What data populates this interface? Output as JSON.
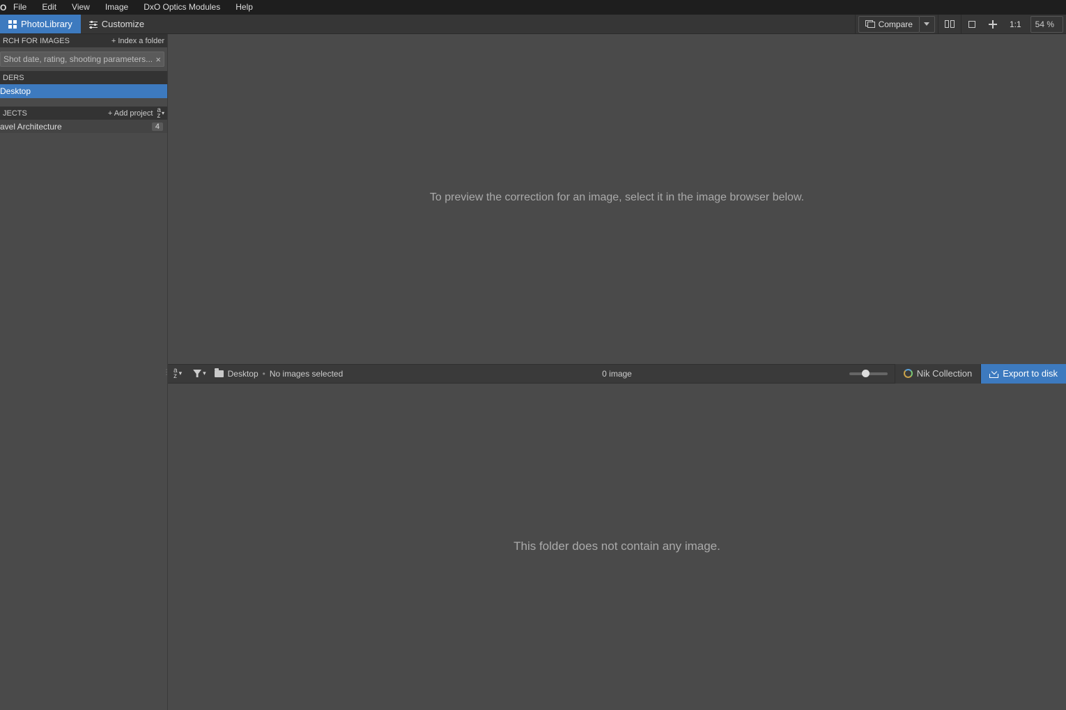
{
  "menubar": {
    "logo": "O",
    "items": [
      "File",
      "Edit",
      "View",
      "Image",
      "DxO Optics Modules",
      "Help"
    ]
  },
  "modebar": {
    "photolibrary": "PhotoLibrary",
    "customize": "Customize",
    "compare": "Compare",
    "ratio": "1:1",
    "zoom": "54 %"
  },
  "sidebar": {
    "search": {
      "header": "RCH FOR IMAGES",
      "index_action": "+ Index a folder",
      "placeholder": "Shot date, rating, shooting parameters..."
    },
    "folders": {
      "header": "DERS",
      "items": [
        {
          "name": "Desktop"
        }
      ]
    },
    "projects": {
      "header": "JECTS",
      "add_action": "+ Add project",
      "items": [
        {
          "name": "avel Architecture",
          "count": "4"
        }
      ]
    }
  },
  "preview": {
    "empty_text": "To preview the correction for an image, select it in the image browser below."
  },
  "browser_bar": {
    "path_folder": "Desktop",
    "selection": "No images selected",
    "count": "0 image",
    "nik_label": "Nik Collection",
    "export_label": "Export to disk"
  },
  "browser": {
    "empty_text": "This folder does not contain any image."
  }
}
